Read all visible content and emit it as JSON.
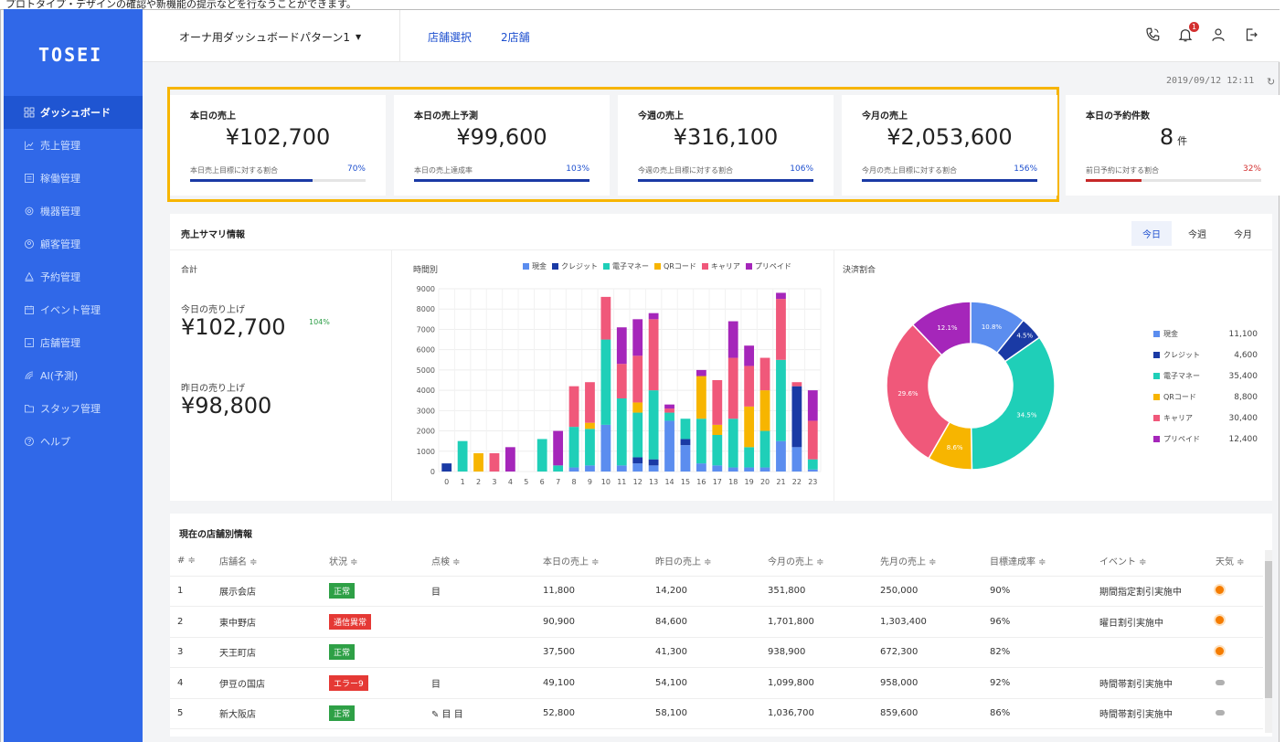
{
  "top_strip": "プロトタイプ・デザインの確認や新機能の提示などを行なうことができます。",
  "logo": "TOSEI",
  "sidebar": {
    "items": [
      {
        "label": "ダッシュボード",
        "icon": "grid-icon",
        "active": true
      },
      {
        "label": "売上管理",
        "icon": "chart-icon"
      },
      {
        "label": "稼働管理",
        "icon": "monitor-icon"
      },
      {
        "label": "機器管理",
        "icon": "gear-icon"
      },
      {
        "label": "顧客管理",
        "icon": "user-icon"
      },
      {
        "label": "予約管理",
        "icon": "bell-icon"
      },
      {
        "label": "イベント管理",
        "icon": "calendar-icon"
      },
      {
        "label": "店舗管理",
        "icon": "store-icon"
      },
      {
        "label": "AI(予測)",
        "icon": "wifi-icon"
      },
      {
        "label": "スタッフ管理",
        "icon": "folder-icon"
      },
      {
        "label": "ヘルプ",
        "icon": "help-icon"
      }
    ]
  },
  "header": {
    "dashboard_select": "オーナ用ダッシュボードパターン1",
    "store_select": "店舗選択",
    "store_count": "2店舗",
    "notification_count": "1"
  },
  "timestamp": "2019/09/12 12:11",
  "kpis": [
    {
      "title": "本日の売上",
      "value": "¥102,700",
      "unit": "",
      "label": "本日売上目標に対する割合",
      "pct": "70%",
      "fill": 0.7,
      "color": "blue"
    },
    {
      "title": "本日の売上予測",
      "value": "¥99,600",
      "unit": "",
      "label": "本日の売上達成率",
      "pct": "103%",
      "fill": 1.0,
      "color": "blue"
    },
    {
      "title": "今週の売上",
      "value": "¥316,100",
      "unit": "",
      "label": "今週の売上目標に対する割合",
      "pct": "106%",
      "fill": 1.0,
      "color": "blue"
    },
    {
      "title": "今月の売上",
      "value": "¥2,053,600",
      "unit": "",
      "label": "今月の売上目標に対する割合",
      "pct": "156%",
      "fill": 1.0,
      "color": "blue"
    },
    {
      "title": "本日の予約件数",
      "value": "8",
      "unit": "件",
      "label": "前日予約に対する割合",
      "pct": "32%",
      "fill": 0.32,
      "color": "red"
    }
  ],
  "summary": {
    "title": "売上サマリ情報",
    "tabs": [
      "今日",
      "今週",
      "今月"
    ],
    "total_label": "合計",
    "today_label": "今日の売り上げ",
    "today_value": "¥102,700",
    "today_pct": "104%",
    "yesterday_label": "昨日の売り上げ",
    "yesterday_value": "¥98,800",
    "hourly_title": "時間別",
    "payment_title": "決済割合"
  },
  "chart_data": [
    {
      "type": "bar",
      "stacked": true,
      "title": "時間別",
      "categories": [
        "0",
        "1",
        "2",
        "3",
        "4",
        "5",
        "6",
        "7",
        "8",
        "9",
        "10",
        "11",
        "12",
        "13",
        "14",
        "15",
        "16",
        "17",
        "18",
        "19",
        "20",
        "21",
        "22",
        "23"
      ],
      "ylim": [
        0,
        9000
      ],
      "yticks": [
        0,
        1000,
        2000,
        3000,
        4000,
        5000,
        6000,
        7000,
        8000,
        9000
      ],
      "grid": true,
      "legend_position": "top",
      "series": [
        {
          "name": "現金",
          "color": "#5b8def",
          "values": [
            0,
            0,
            0,
            0,
            0,
            0,
            0,
            0,
            200,
            300,
            2300,
            300,
            400,
            300,
            2500,
            1300,
            400,
            300,
            200,
            200,
            200,
            1500,
            1200,
            100
          ]
        },
        {
          "name": "クレジット",
          "color": "#1a3aa5",
          "values": [
            400,
            0,
            0,
            0,
            0,
            0,
            0,
            0,
            0,
            0,
            0,
            0,
            300,
            300,
            0,
            300,
            0,
            0,
            0,
            0,
            0,
            0,
            3000,
            0
          ]
        },
        {
          "name": "電子マネー",
          "color": "#1fcfb8",
          "values": [
            0,
            1500,
            0,
            0,
            0,
            0,
            1600,
            300,
            2000,
            1800,
            4200,
            3300,
            2200,
            3400,
            400,
            1000,
            2200,
            1500,
            2400,
            1000,
            1800,
            4000,
            0,
            500
          ]
        },
        {
          "name": "QRコード",
          "color": "#f7b500",
          "values": [
            0,
            0,
            900,
            0,
            0,
            0,
            0,
            0,
            0,
            300,
            0,
            0,
            500,
            0,
            0,
            0,
            2100,
            500,
            0,
            2000,
            2000,
            0,
            0,
            0
          ]
        },
        {
          "name": "キャリア",
          "color": "#f0587a",
          "values": [
            0,
            0,
            0,
            900,
            0,
            0,
            0,
            0,
            2000,
            2000,
            2100,
            1700,
            2300,
            3500,
            200,
            0,
            0,
            2200,
            3000,
            2000,
            1600,
            3000,
            200,
            1900
          ]
        },
        {
          "name": "プリペイド",
          "color": "#a526ba",
          "values": [
            0,
            0,
            0,
            0,
            1200,
            0,
            0,
            1700,
            0,
            0,
            0,
            1800,
            1800,
            300,
            200,
            0,
            300,
            0,
            1800,
            1000,
            0,
            300,
            0,
            1500
          ]
        }
      ]
    },
    {
      "type": "pie",
      "title": "決済割合",
      "donut": true,
      "slices": [
        {
          "name": "現金",
          "value": 11100,
          "label": "10.8%",
          "color": "#5b8def"
        },
        {
          "name": "クレジット",
          "value": 4600,
          "label": "4.5%",
          "color": "#1a3aa5"
        },
        {
          "name": "電子マネー",
          "value": 35400,
          "label": "34.5%",
          "color": "#1fcfb8"
        },
        {
          "name": "QRコード",
          "value": 8800,
          "label": "8.6%",
          "color": "#f7b500"
        },
        {
          "name": "キャリア",
          "value": 30400,
          "label": "29.6%",
          "color": "#f0587a"
        },
        {
          "name": "プリペイド",
          "value": 12400,
          "label": "12.1%",
          "color": "#a526ba"
        }
      ],
      "legend_position": "right"
    }
  ],
  "pie_values_display": [
    "11,100",
    "4,600",
    "35,400",
    "8,800",
    "30,400",
    "12,400"
  ],
  "stores": {
    "title": "現在の店舗別情報",
    "columns": [
      "# ≑",
      "店舗名 ≑",
      "状況 ≑",
      "点検 ≑",
      "本日の売上 ≑",
      "昨日の売上 ≑",
      "今月の売上 ≑",
      "先月の売上 ≑",
      "目標達成率 ≑",
      "イベント ≑",
      "天気 ≑"
    ],
    "rows": [
      {
        "no": "1",
        "name": "展示会店",
        "status": "正常",
        "status_ok": true,
        "check": "目",
        "today": "11,800",
        "yesterday": "14,200",
        "month": "351,800",
        "last_month": "250,000",
        "rate": "90%",
        "event": "期間指定割引実施中",
        "weather": "sun"
      },
      {
        "no": "2",
        "name": "東中野店",
        "status": "通信異常",
        "status_ok": false,
        "check": "",
        "today": "90,900",
        "yesterday": "84,600",
        "month": "1,701,800",
        "last_month": "1,303,400",
        "rate": "96%",
        "event": "曜日割引実施中",
        "weather": "sun"
      },
      {
        "no": "3",
        "name": "天王町店",
        "status": "正常",
        "status_ok": true,
        "check": "",
        "today": "37,500",
        "yesterday": "41,300",
        "month": "938,900",
        "last_month": "672,300",
        "rate": "82%",
        "event": "",
        "weather": "sun"
      },
      {
        "no": "4",
        "name": "伊豆の国店",
        "status": "エラー9",
        "status_ok": false,
        "check": "目",
        "today": "49,100",
        "yesterday": "54,100",
        "month": "1,099,800",
        "last_month": "958,000",
        "rate": "92%",
        "event": "時間帯割引実施中",
        "weather": "cloud"
      },
      {
        "no": "5",
        "name": "新大阪店",
        "status": "正常",
        "status_ok": true,
        "check": "✎ 目 目",
        "today": "52,800",
        "yesterday": "58,100",
        "month": "1,036,700",
        "last_month": "859,600",
        "rate": "86%",
        "event": "時間帯割引実施中",
        "weather": "cloud"
      }
    ]
  }
}
